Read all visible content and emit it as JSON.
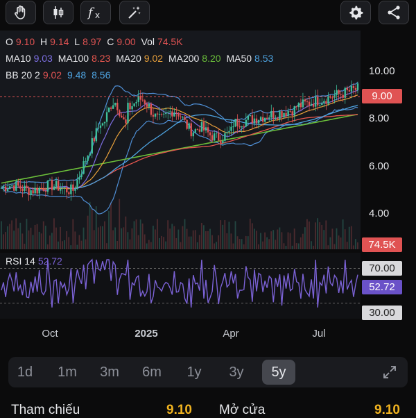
{
  "toolbar": {
    "left": [
      {
        "icon": "hand-icon"
      },
      {
        "icon": "candlestick-icon"
      },
      {
        "icon": "function-icon",
        "label": "fx"
      },
      {
        "icon": "magic-wand-icon"
      }
    ],
    "right": [
      {
        "icon": "gear-icon"
      },
      {
        "icon": "share-icon"
      }
    ]
  },
  "legend": {
    "ohlc": {
      "o_label": "O",
      "o": "9.10",
      "h_label": "H",
      "h": "9.14",
      "l_label": "L",
      "l": "8.97",
      "c_label": "C",
      "c": "9.00",
      "vol_label": "Vol",
      "vol": "74.5K"
    },
    "ma": [
      {
        "label": "MA10",
        "value": "9.03",
        "color": "#7d6fe3"
      },
      {
        "label": "MA100",
        "value": "8.23",
        "color": "#e8574f"
      },
      {
        "label": "MA20",
        "value": "9.02",
        "color": "#e9a13b"
      },
      {
        "label": "MA200",
        "value": "8.20",
        "color": "#6bbf3a"
      },
      {
        "label": "MA50",
        "value": "8.53",
        "color": "#4ea3e0"
      }
    ],
    "bb": {
      "label": "BB 20 2",
      "v1": "9.02",
      "v2": "9.48",
      "v3": "8.56"
    }
  },
  "price_axis": {
    "labels": [
      "10.00",
      "8.00",
      "6.00",
      "4.00"
    ],
    "current": "9.00",
    "volume_tag": "74.5K"
  },
  "rsi": {
    "label": "RSI 14",
    "value": "52.72",
    "upper": "70.00",
    "lower": "30.00"
  },
  "x_axis": {
    "labels": [
      "Oct",
      "2025",
      "Apr",
      "Jul"
    ]
  },
  "ranges": {
    "items": [
      "1d",
      "1m",
      "3m",
      "6m",
      "1y",
      "3y",
      "5y"
    ],
    "active": "5y"
  },
  "stats": {
    "ref_label": "Tham chiếu",
    "ref_value": "9.10",
    "open_label": "Mở cửa",
    "open_value": "9.10"
  },
  "colors": {
    "up": "#3fbf9b",
    "down": "#e05353",
    "rsi": "#7b62d6",
    "bb": "#4f8fd6",
    "accent": "#f0b320"
  }
}
